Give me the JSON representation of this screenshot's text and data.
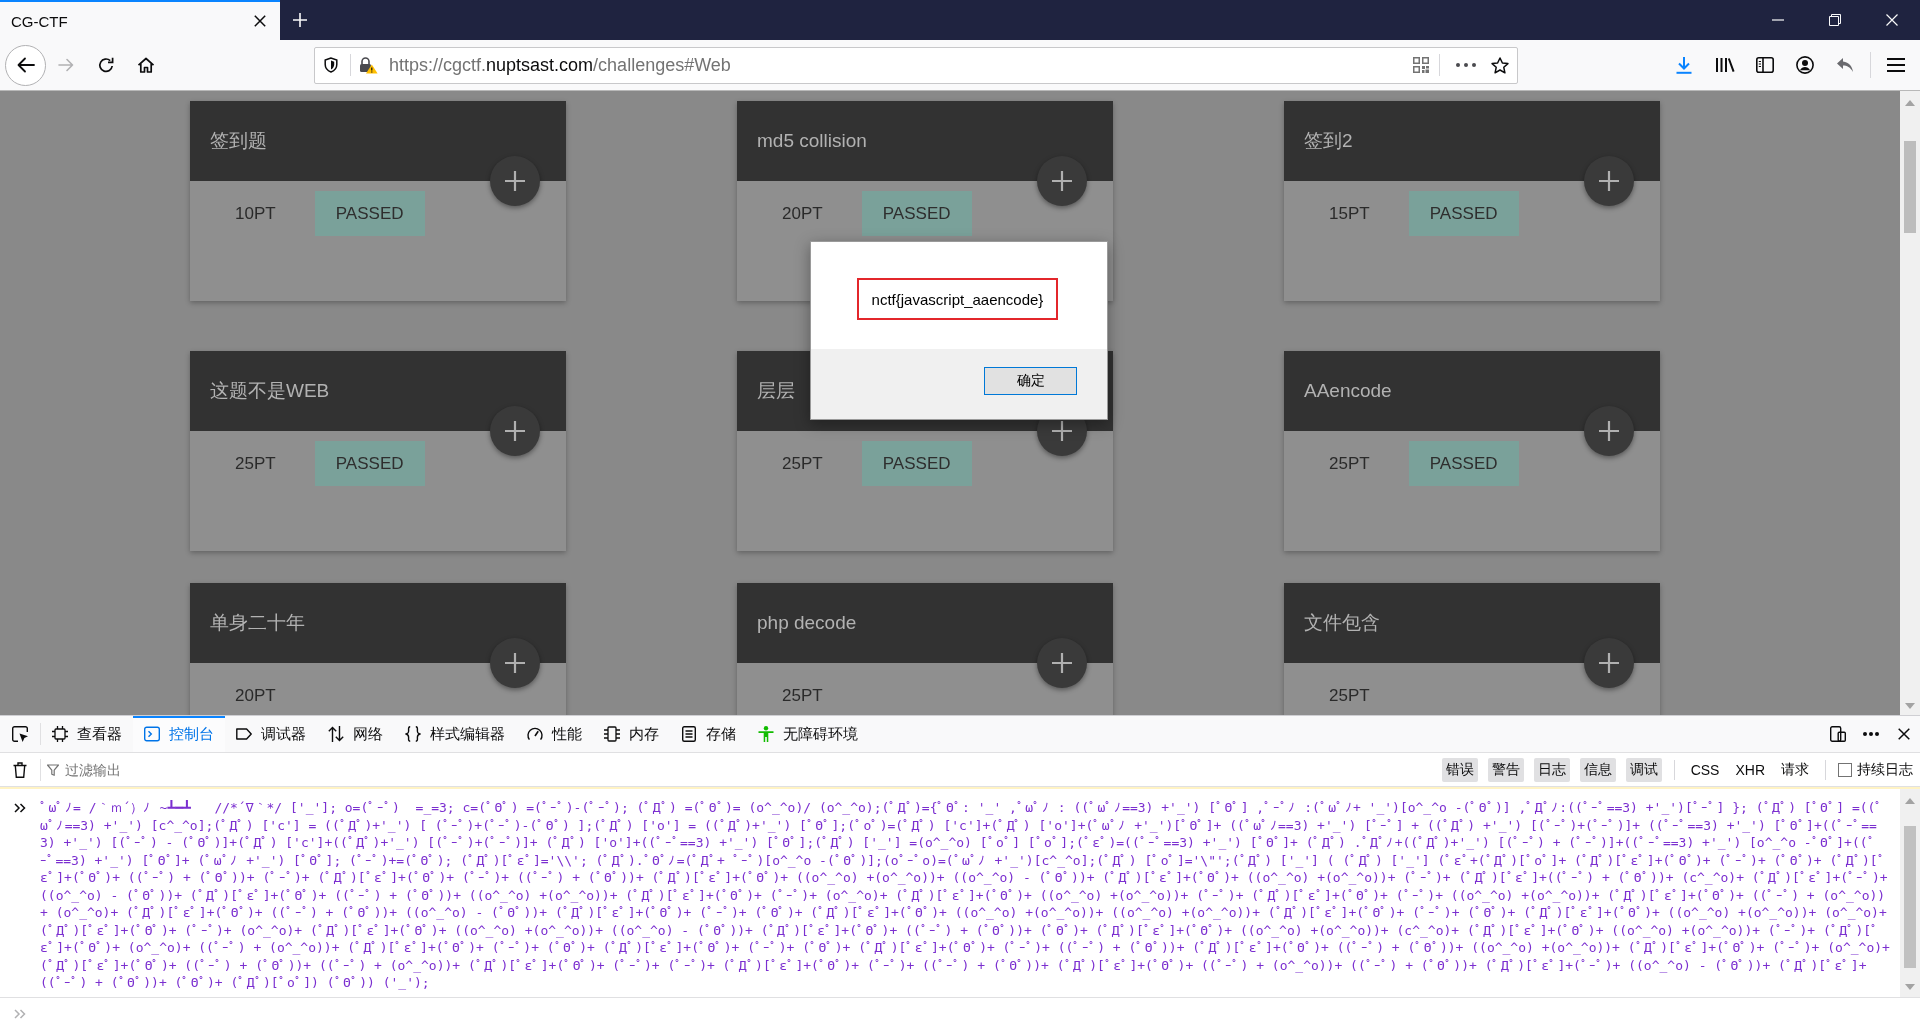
{
  "browser": {
    "tabs": [
      {
        "title": "CG-CTF",
        "selected": true
      }
    ],
    "url": "https://cgctf.**nuptsast.com**/challenges#Web"
  },
  "page": {
    "challenges": [
      {
        "title": "签到题",
        "points": "10PT",
        "badge": "PASSED"
      },
      {
        "title": "md5 collision",
        "points": "20PT",
        "badge": "PASSED"
      },
      {
        "title": "签到2",
        "points": "15PT",
        "badge": "PASSED"
      },
      {
        "title": "这题不是WEB",
        "points": "25PT",
        "badge": "PASSED"
      },
      {
        "title": "层层",
        "points": "25PT",
        "badge": "PASSED"
      },
      {
        "title": "AAencode",
        "points": "25PT",
        "badge": "PASSED"
      },
      {
        "title": "单身二十年",
        "points": "20PT"
      },
      {
        "title": "php decode",
        "points": "25PT"
      },
      {
        "title": "文件包含",
        "points": "25PT"
      }
    ]
  },
  "dialog": {
    "message": "nctf{javascript_aaencode}",
    "button": "确定"
  },
  "devtools": {
    "tabs": [
      {
        "label": "查看器",
        "selected": false
      },
      {
        "label": "控制台",
        "selected": true
      },
      {
        "label": "调试器",
        "selected": false
      },
      {
        "label": "网络",
        "selected": false
      },
      {
        "label": "样式编辑器",
        "selected": false
      },
      {
        "label": "性能",
        "selected": false
      },
      {
        "label": "内存",
        "selected": false
      },
      {
        "label": "存储",
        "selected": false
      },
      {
        "label": "无障碍环境",
        "selected": false
      }
    ],
    "filter": {
      "placeholder": "过滤输出"
    },
    "level_filters": [
      {
        "label": "错误",
        "on": true
      },
      {
        "label": "警告",
        "on": true
      },
      {
        "label": "日志",
        "on": true
      },
      {
        "label": "信息",
        "on": true
      },
      {
        "label": "调试",
        "on": true
      }
    ],
    "type_filters": [
      {
        "label": "CSS",
        "on": false
      },
      {
        "label": "XHR",
        "on": false
      },
      {
        "label": "请求",
        "on": false
      }
    ],
    "persist_logs": {
      "label": "持续日志",
      "checked": false
    },
    "console": {
      "messages": [
        {
          "text": "ﾟωﾟﾉ= /｀ｍ´）ﾉ ~┻━┻   //*´∇｀*/ ['_']; o=(ﾟｰﾟ)  =_=3; c=(ﾟΘﾟ) =(ﾟｰﾟ)-(ﾟｰﾟ); (ﾟДﾟ) =(ﾟΘﾟ)= (o^_^o)/ (o^_^o);(ﾟДﾟ)={ﾟΘﾟ: '_' ,ﾟωﾟﾉ : ((ﾟωﾟﾉ==3) +'_') [ﾟΘﾟ] ,ﾟｰﾟﾉ :(ﾟωﾟﾉ+ '_')[o^_^o -(ﾟΘﾟ)] ,ﾟДﾟﾉ:((ﾟｰﾟ==3) +'_')[ﾟｰﾟ] }; (ﾟДﾟ) [ﾟΘﾟ] =((ﾟωﾟﾉ==3) +'_') [c^_^o];(ﾟДﾟ) ['c'] = ((ﾟДﾟ)+'_') [ (ﾟｰﾟ)+(ﾟｰﾟ)-(ﾟΘﾟ) ];(ﾟДﾟ) ['o'] = ((ﾟДﾟ)+'_') [ﾟΘﾟ];(ﾟoﾟ)=(ﾟДﾟ) ['c']+(ﾟДﾟ) ['o']+(ﾟωﾟﾉ +'_')[ﾟΘﾟ]+ ((ﾟωﾟﾉ==3) +'_') [ﾟｰﾟ] + ((ﾟДﾟ) +'_') [(ﾟｰﾟ)+(ﾟｰﾟ)]+ ((ﾟｰﾟ==3) +'_') [ﾟΘﾟ]+((ﾟｰﾟ==3) +'_') [(ﾟｰﾟ) - (ﾟΘﾟ)]+(ﾟДﾟ) ['c']+((ﾟДﾟ)+'_') [(ﾟｰﾟ)+(ﾟｰﾟ)]+ (ﾟДﾟ) ['o']+((ﾟｰﾟ==3) +'_') [ﾟΘﾟ];(ﾟДﾟ) ['_'] =(o^_^o) [ﾟoﾟ] [ﾟoﾟ];(ﾟεﾟ)=((ﾟｰﾟ==3) +'_') [ﾟΘﾟ]+ (ﾟДﾟ) .ﾟДﾟﾉ+((ﾟДﾟ)+'_') [(ﾟｰﾟ) + (ﾟｰﾟ)]+((ﾟｰﾟ==3) +'_') [o^_^o -ﾟΘﾟ]+((ﾟｰﾟ==3) +'_') [ﾟΘﾟ]+ (ﾟωﾟﾉ +'_') [ﾟΘﾟ]; (ﾟｰﾟ)+=(ﾟΘﾟ); (ﾟДﾟ)[ﾟεﾟ]='\\\\'; (ﾟДﾟ).ﾟΘﾟﾉ=(ﾟДﾟ+ ﾟｰﾟ)[o^_^o -(ﾟΘﾟ)];(oﾟｰﾟo)=(ﾟωﾟﾉ +'_')[c^_^o];(ﾟДﾟ) [ﾟoﾟ]='\\\"';(ﾟДﾟ) ['_'] ( (ﾟДﾟ) ['_'] (ﾟεﾟ+(ﾟДﾟ)[ﾟoﾟ]+ (ﾟДﾟ)[ﾟεﾟ]+(ﾟΘﾟ)+ (ﾟｰﾟ)+ (ﾟΘﾟ)+ (ﾟДﾟ)[ﾟεﾟ]+(ﾟΘﾟ)+ ((ﾟｰﾟ) + (ﾟΘﾟ))+ (ﾟｰﾟ)+ (ﾟДﾟ)[ﾟεﾟ]+(ﾟΘﾟ)+ (ﾟｰﾟ)+ ((ﾟｰﾟ) + (ﾟΘﾟ))+ (ﾟДﾟ)[ﾟεﾟ]+(ﾟΘﾟ)+ ((o^_^o) +(o^_^o))+ ((o^_^o) - (ﾟΘﾟ))+ (ﾟДﾟ)[ﾟεﾟ]+(ﾟΘﾟ)+ ((o^_^o) +(o^_^o))+ (ﾟｰﾟ)+ (ﾟДﾟ)[ﾟεﾟ]+((ﾟｰﾟ) + (ﾟΘﾟ))+ (c^_^o)+ (ﾟДﾟ)[ﾟεﾟ]+(ﾟｰﾟ)+ ((o^_^o) - (ﾟΘﾟ))+ (ﾟДﾟ)[ﾟεﾟ]+(ﾟΘﾟ)+ ((ﾟｰﾟ) + (ﾟΘﾟ))+ ((o^_^o) +(o^_^o))+ (ﾟДﾟ)[ﾟεﾟ]+(ﾟΘﾟ)+ (ﾟｰﾟ)+ (o^_^o)+ (ﾟДﾟ)[ﾟεﾟ]+(ﾟΘﾟ)+ ((o^_^o) +(o^_^o))+ (ﾟｰﾟ)+ (ﾟДﾟ)[ﾟεﾟ]+(ﾟΘﾟ)+ (ﾟｰﾟ)+ ((o^_^o) +(o^_^o))+ (ﾟДﾟ)[ﾟεﾟ]+(ﾟΘﾟ)+ ((ﾟｰﾟ) + (o^_^o))+ (o^_^o)+ (ﾟДﾟ)[ﾟεﾟ]+(ﾟΘﾟ)+ ((ﾟｰﾟ) + (ﾟΘﾟ))+ ((o^_^o) - (ﾟΘﾟ))+ (ﾟДﾟ)[ﾟεﾟ]+(ﾟΘﾟ)+ (ﾟｰﾟ)+ (ﾟΘﾟ)+ (ﾟДﾟ)[ﾟεﾟ]+(ﾟΘﾟ)+ ((o^_^o) +(o^_^o))+ ((o^_^o) +(o^_^o))+ (ﾟДﾟ)[ﾟεﾟ]+(ﾟΘﾟ)+ (ﾟｰﾟ)+ (ﾟΘﾟ)+ (ﾟДﾟ)[ﾟεﾟ]+(ﾟΘﾟ)+ ((o^_^o) +(o^_^o))+ (o^_^o)+ (ﾟДﾟ)[ﾟεﾟ]+(ﾟΘﾟ)+ (ﾟｰﾟ)+ (o^_^o)+ (ﾟДﾟ)[ﾟεﾟ]+(ﾟΘﾟ)+ ((o^_^o) +(o^_^o))+ ((o^_^o) - (ﾟΘﾟ))+ (ﾟДﾟ)[ﾟεﾟ]+(ﾟΘﾟ)+ ((ﾟｰﾟ) + (ﾟΘﾟ))+ (ﾟΘﾟ)+ (ﾟДﾟ)[ﾟεﾟ]+(ﾟΘﾟ)+ ((o^_^o) +(o^_^o))+ (c^_^o)+ (ﾟДﾟ)[ﾟεﾟ]+(ﾟΘﾟ)+ ((o^_^o) +(o^_^o))+ (ﾟｰﾟ)+ (ﾟДﾟ)[ﾟεﾟ]+(ﾟΘﾟ)+ (o^_^o)+ ((ﾟｰﾟ) + (o^_^o))+ (ﾟДﾟ)[ﾟεﾟ]+(ﾟΘﾟ)+ (ﾟｰﾟ)+ (ﾟΘﾟ)+ (ﾟДﾟ)[ﾟεﾟ]+(ﾟΘﾟ)+ (ﾟｰﾟ)+ (ﾟΘﾟ)+ (ﾟДﾟ)[ﾟεﾟ]+(ﾟΘﾟ)+ (ﾟｰﾟ)+ ((ﾟｰﾟ) + (ﾟΘﾟ))+ (ﾟДﾟ)[ﾟεﾟ]+(ﾟΘﾟ)+ ((ﾟｰﾟ) + (ﾟΘﾟ))+ ((o^_^o) +(o^_^o))+ (ﾟДﾟ)[ﾟεﾟ]+(ﾟΘﾟ)+ (ﾟｰﾟ)+ (o^_^o)+ (ﾟДﾟ)[ﾟεﾟ]+(ﾟΘﾟ)+ ((ﾟｰﾟ) + (ﾟΘﾟ))+ ((ﾟｰﾟ) + (o^_^o))+ (ﾟДﾟ)[ﾟεﾟ]+(ﾟΘﾟ)+ (ﾟｰﾟ)+ (ﾟｰﾟ)+ (ﾟДﾟ)[ﾟεﾟ]+(ﾟΘﾟ)+ (ﾟｰﾟ)+ ((ﾟｰﾟ) + (ﾟΘﾟ))+ (ﾟДﾟ)[ﾟεﾟ]+(ﾟΘﾟ)+ ((ﾟｰﾟ) + (o^_^o))+ ((ﾟｰﾟ) + (ﾟΘﾟ))+ (ﾟДﾟ)[ﾟεﾟ]+(ﾟｰﾟ)+ ((o^_^o) - (ﾟΘﾟ))+ (ﾟДﾟ)[ﾟεﾟ]+((ﾟｰﾟ) + (ﾟΘﾟ))+ (ﾟΘﾟ)+ (ﾟДﾟ)[ﾟoﾟ]) (ﾟΘﾟ)) ('_');"
        }
      ]
    }
  }
}
